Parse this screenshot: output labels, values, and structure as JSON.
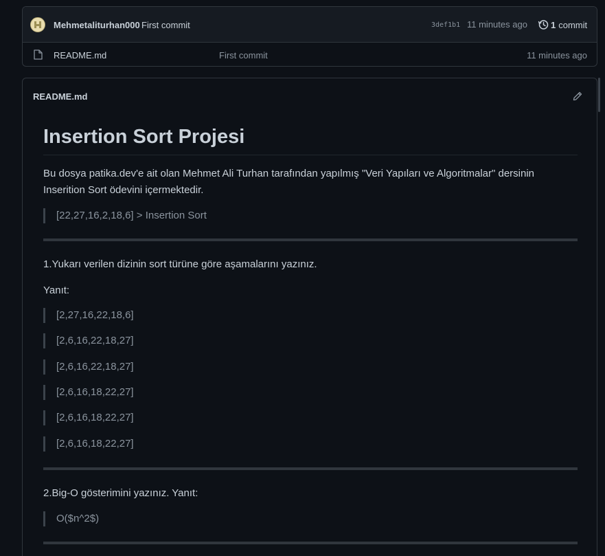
{
  "commit": {
    "author": "Mehmetaliturhan000",
    "message": "First commit",
    "sha": "3def1b1",
    "time": "11 minutes ago",
    "count": "1",
    "count_label": "commit"
  },
  "files": [
    {
      "name": "README.md",
      "commit_message": "First commit",
      "time": "11 minutes ago"
    }
  ],
  "readme": {
    "filename": "README.md",
    "title": "Insertion Sort Projesi",
    "intro": "Bu dosya patika.dev'e ait olan Mehmet Ali Turhan tarafından yapılmış \"Veri Yapıları ve Algoritmalar\" dersinin Inserition Sort ödevini içermektedir.",
    "quote_array": "[22,27,16,2,18,6] > Insertion Sort",
    "q1": "1.Yukarı verilen dizinin sort türüne göre aşamalarını yazınız.",
    "answer_label": "Yanıt:",
    "steps": [
      "[2,27,16,22,18,6]",
      "[2,6,16,22,18,27]",
      "[2,6,16,22,18,27]",
      "[2,6,16,18,22,27]",
      "[2,6,16,18,22,27]",
      "[2,6,16,18,22,27]"
    ],
    "q2": "2.Big-O gösterimini yazınız. Yanıt:",
    "bigo": "O($n^2$)"
  },
  "icons": {
    "history": "history-icon",
    "file": "file-icon",
    "edit": "pencil-icon"
  }
}
